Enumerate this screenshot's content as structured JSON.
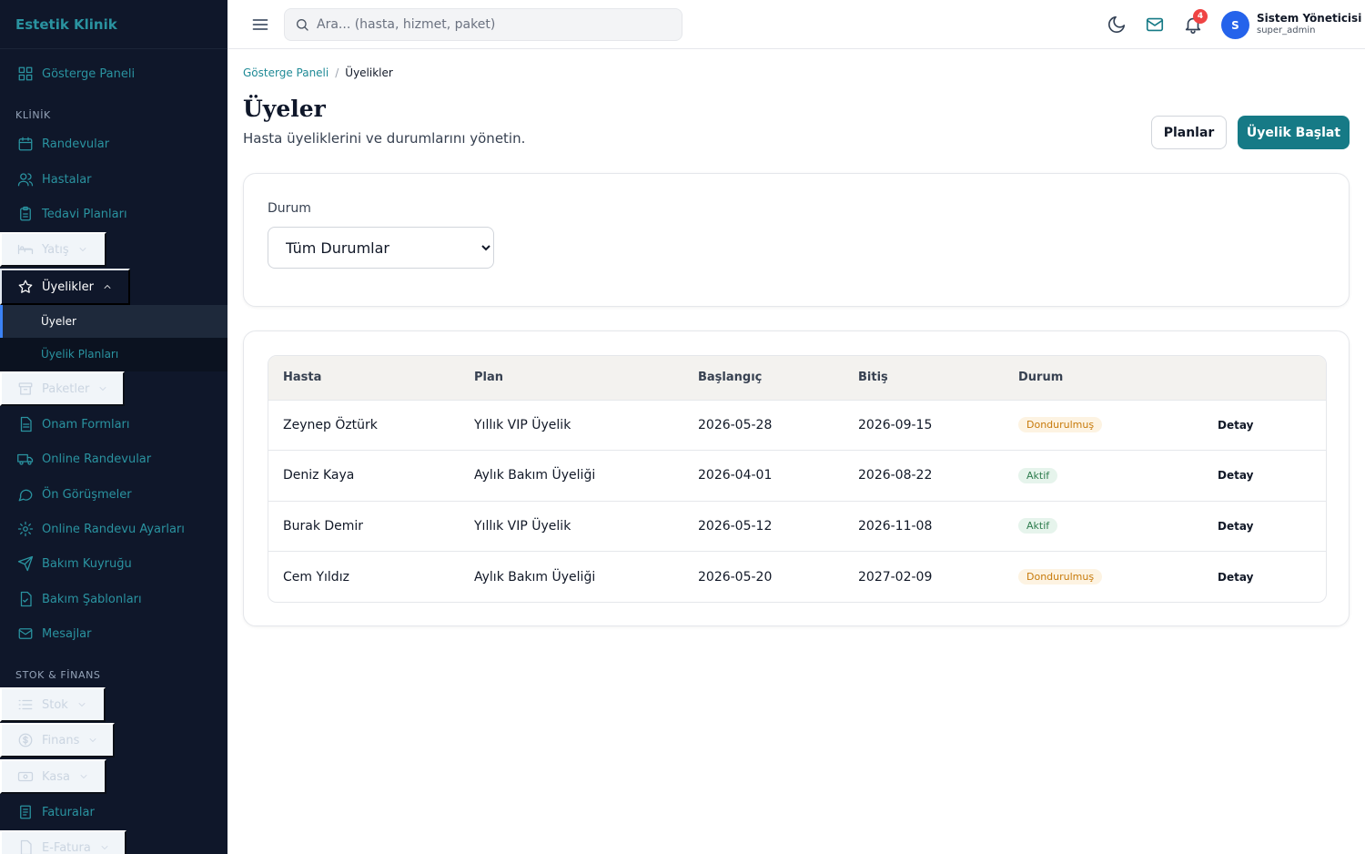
{
  "brand": "Estetik Klinik",
  "sidebar": {
    "dashboard": "Gösterge Paneli",
    "section_klinik": "KLİNİK",
    "randevular": "Randevular",
    "hastalar": "Hastalar",
    "tedavi_planlari": "Tedavi Planları",
    "yatis": "Yatış",
    "uyelikler": "Üyelikler",
    "uyeler": "Üyeler",
    "uyelik_planlari": "Üyelik Planları",
    "paketler": "Paketler",
    "onam_formlari": "Onam Formları",
    "online_randevular": "Online Randevular",
    "on_gorusmeler": "Ön Görüşmeler",
    "online_randevu_ayarlari": "Online Randevu Ayarları",
    "bakim_kuyrugu": "Bakım Kuyruğu",
    "bakim_sablonlari": "Bakım Şablonları",
    "mesajlar": "Mesajlar",
    "section_stok": "STOK & FİNANS",
    "stok": "Stok",
    "finans": "Finans",
    "kasa": "Kasa",
    "faturalar": "Faturalar",
    "e_fatura": "E-Fatura"
  },
  "topbar": {
    "search_placeholder": "Ara... (hasta, hizmet, paket)",
    "notification_count": "4",
    "avatar_initial": "S",
    "user_name": "Sistem Yöneticisi",
    "user_role": "super_admin"
  },
  "breadcrumb": {
    "home": "Gösterge Paneli",
    "separator": "/",
    "current": "Üyelikler"
  },
  "page": {
    "title": "Üyeler",
    "subtitle": "Hasta üyeliklerini ve durumlarını yönetin.",
    "plans_button": "Planlar",
    "start_button": "Üyelik Başlat"
  },
  "filter": {
    "label": "Durum",
    "selected": "Tüm Durumlar"
  },
  "table": {
    "headers": [
      "Hasta",
      "Plan",
      "Başlangıç",
      "Bitiş",
      "Durum",
      ""
    ],
    "rows": [
      {
        "patient": "Zeynep Öztürk",
        "plan": "Yıllık VIP Üyelik",
        "start": "2026-05-28",
        "end": "2026-09-15",
        "status": "Dondurulmuş",
        "action": "Detay"
      },
      {
        "patient": "Deniz Kaya",
        "plan": "Aylık Bakım Üyeliği",
        "start": "2026-04-01",
        "end": "2026-08-22",
        "status": "Aktif",
        "action": "Detay"
      },
      {
        "patient": "Burak Demir",
        "plan": "Yıllık VIP Üyelik",
        "start": "2026-05-12",
        "end": "2026-11-08",
        "status": "Aktif",
        "action": "Detay"
      },
      {
        "patient": "Cem Yıldız",
        "plan": "Aylık Bakım Üyeliği",
        "start": "2026-05-20",
        "end": "2027-02-09",
        "status": "Dondurulmuş",
        "action": "Detay"
      }
    ]
  },
  "colors": {
    "sidebar_bg": "#0f172a",
    "accent": "#167a86",
    "frozen": "#c77a0a",
    "active": "#2f7d4f",
    "badge": "#ef4444"
  }
}
